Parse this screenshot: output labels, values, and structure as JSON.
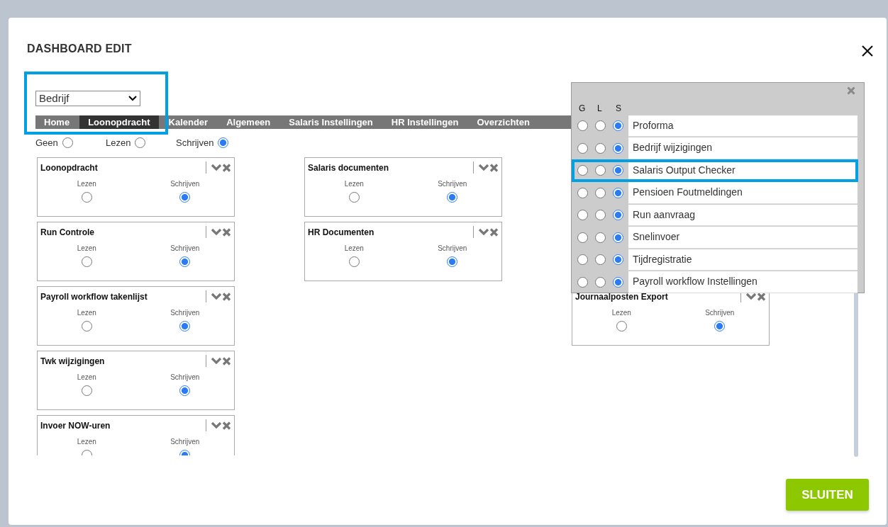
{
  "dialog": {
    "title": "DASHBOARD EDIT"
  },
  "scope_select": {
    "value": "Bedrijf"
  },
  "tabs_highlighted": true,
  "tabs": [
    {
      "label": "Home",
      "selected": false
    },
    {
      "label": "Loonopdracht",
      "selected": true
    },
    {
      "label": "Kalender",
      "selected": false
    },
    {
      "label": "Algemeen",
      "selected": false
    },
    {
      "label": "Salaris Instellingen",
      "selected": false
    },
    {
      "label": "HR Instellingen",
      "selected": false
    },
    {
      "label": "Overzichten",
      "selected": false
    }
  ],
  "global_access": [
    {
      "label": "Geen",
      "selected": false
    },
    {
      "label": "Lezen",
      "selected": false
    },
    {
      "label": "Schrijven",
      "selected": true
    }
  ],
  "widget_columns": [
    [
      {
        "title": "Loonopdracht",
        "options": [
          {
            "label": "Lezen",
            "selected": false
          },
          {
            "label": "Schrijven",
            "selected": true
          }
        ]
      },
      {
        "title": "Run Controle",
        "options": [
          {
            "label": "Lezen",
            "selected": false
          },
          {
            "label": "Schrijven",
            "selected": true
          }
        ]
      },
      {
        "title": "Payroll workflow takenlijst",
        "options": [
          {
            "label": "Lezen",
            "selected": false
          },
          {
            "label": "Schrijven",
            "selected": true
          }
        ]
      },
      {
        "title": "Twk wijzigingen",
        "options": [
          {
            "label": "Lezen",
            "selected": false
          },
          {
            "label": "Schrijven",
            "selected": true
          }
        ]
      },
      {
        "title": "Invoer NOW-uren",
        "options": [
          {
            "label": "Lezen",
            "selected": false
          },
          {
            "label": "Schrijven",
            "selected": true
          }
        ]
      }
    ],
    [
      {
        "title": "Salaris documenten",
        "options": [
          {
            "label": "Lezen",
            "selected": false
          },
          {
            "label": "Schrijven",
            "selected": true
          }
        ]
      },
      {
        "title": "HR Documenten",
        "options": [
          {
            "label": "Lezen",
            "selected": false
          },
          {
            "label": "Schrijven",
            "selected": true
          }
        ]
      }
    ],
    [
      {
        "title": "Journaalposten Export",
        "options": [
          {
            "label": "Lezen",
            "selected": false
          },
          {
            "label": "Schrijven",
            "selected": true
          }
        ]
      }
    ]
  ],
  "popup": {
    "headers": [
      "G",
      "L",
      "S"
    ],
    "rows": [
      {
        "label": "Proforma",
        "highlighted": false,
        "options": [
          {
            "selected": false
          },
          {
            "selected": false
          },
          {
            "selected": true
          }
        ]
      },
      {
        "label": "Bedrijf wijzigingen",
        "highlighted": false,
        "options": [
          {
            "selected": false
          },
          {
            "selected": false
          },
          {
            "selected": true
          }
        ]
      },
      {
        "label": "Salaris Output Checker",
        "highlighted": true,
        "options": [
          {
            "selected": false
          },
          {
            "selected": false
          },
          {
            "selected": true
          }
        ]
      },
      {
        "label": "Pensioen Foutmeldingen",
        "highlighted": false,
        "options": [
          {
            "selected": false
          },
          {
            "selected": false
          },
          {
            "selected": true
          }
        ]
      },
      {
        "label": "Run aanvraag",
        "highlighted": false,
        "options": [
          {
            "selected": false
          },
          {
            "selected": false
          },
          {
            "selected": true
          }
        ]
      },
      {
        "label": "Snelinvoer",
        "highlighted": false,
        "options": [
          {
            "selected": false
          },
          {
            "selected": false
          },
          {
            "selected": true
          }
        ]
      },
      {
        "label": "Tijdregistratie",
        "highlighted": false,
        "options": [
          {
            "selected": false
          },
          {
            "selected": false
          },
          {
            "selected": true
          }
        ]
      },
      {
        "label": "Payroll workflow Instellingen",
        "highlighted": false,
        "options": [
          {
            "selected": false
          },
          {
            "selected": false
          },
          {
            "selected": true
          }
        ]
      }
    ]
  },
  "close_button": "SLUITEN"
}
